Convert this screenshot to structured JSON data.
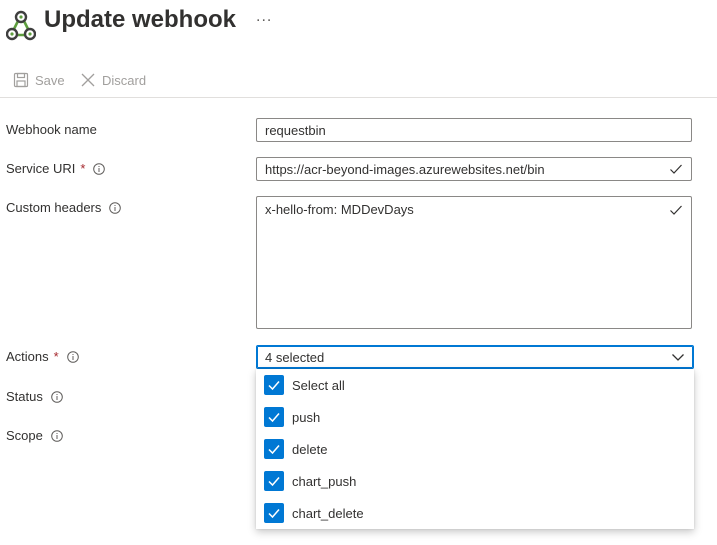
{
  "header": {
    "title": "Update webhook",
    "more_label": "...",
    "icon": "webhook-icon"
  },
  "toolbar": {
    "save_label": "Save",
    "discard_label": "Discard"
  },
  "form": {
    "webhook_name": {
      "label": "Webhook name",
      "value": "requestbin"
    },
    "service_uri": {
      "label": "Service URI",
      "required_mark": "*",
      "value": "https://acr-beyond-images.azurewebsites.net/bin"
    },
    "custom_headers": {
      "label": "Custom headers",
      "value": "x-hello-from: MDDevDays"
    },
    "actions": {
      "label": "Actions",
      "required_mark": "*",
      "selected_text": "4 selected",
      "options": [
        {
          "label": "Select all",
          "checked": true
        },
        {
          "label": "push",
          "checked": true
        },
        {
          "label": "delete",
          "checked": true
        },
        {
          "label": "chart_push",
          "checked": true
        },
        {
          "label": "chart_delete",
          "checked": true
        }
      ]
    },
    "status": {
      "label": "Status"
    },
    "scope": {
      "label": "Scope"
    }
  },
  "colors": {
    "accent": "#0078d4",
    "required": "#a4262c",
    "disabled_text": "#a19f9d",
    "logo_green": "#5e9e3e"
  }
}
